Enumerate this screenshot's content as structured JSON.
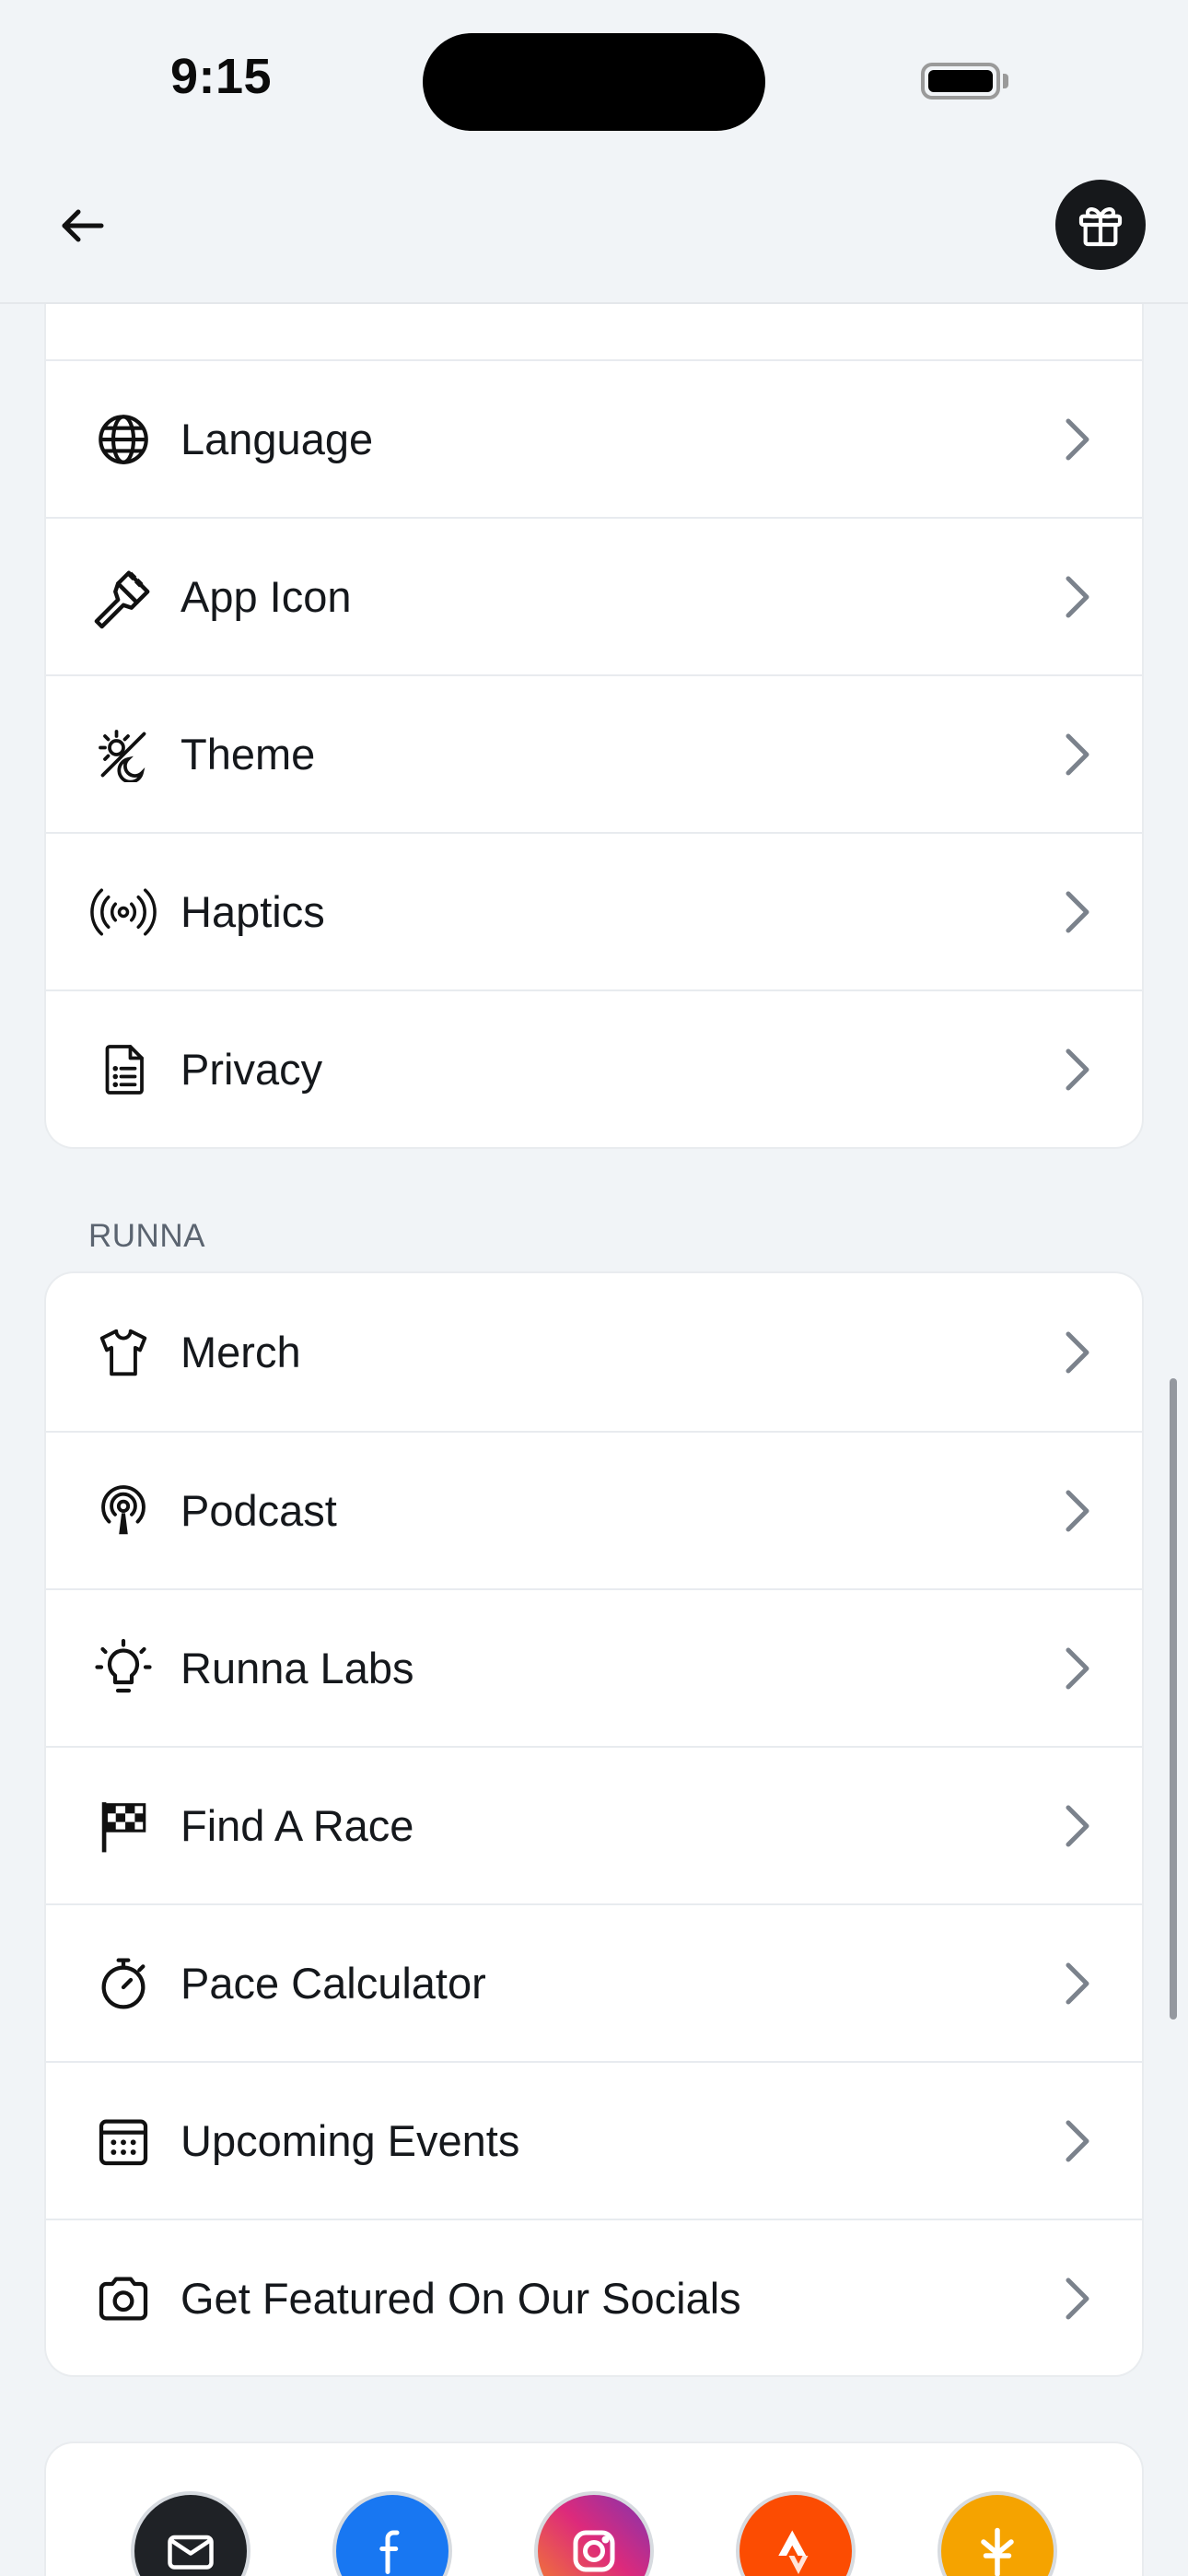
{
  "status": {
    "time": "9:15"
  },
  "settings_rows": [
    {
      "label": "Language",
      "icon": "globe-icon"
    },
    {
      "label": "App Icon",
      "icon": "paintbrush-icon"
    },
    {
      "label": "Theme",
      "icon": "theme-icon"
    },
    {
      "label": "Haptics",
      "icon": "haptics-icon"
    },
    {
      "label": "Privacy",
      "icon": "document-list-icon"
    }
  ],
  "runna_section": {
    "header": "RUNNA",
    "rows": [
      {
        "label": "Merch",
        "icon": "tshirt-icon"
      },
      {
        "label": "Podcast",
        "icon": "podcast-icon"
      },
      {
        "label": "Runna Labs",
        "icon": "lightbulb-icon"
      },
      {
        "label": "Find A Race",
        "icon": "checkered-flag-icon"
      },
      {
        "label": "Pace Calculator",
        "icon": "stopwatch-icon"
      },
      {
        "label": "Upcoming Events",
        "icon": "calendar-icon"
      },
      {
        "label": "Get Featured On Our Socials",
        "icon": "camera-icon"
      }
    ]
  },
  "socials": [
    {
      "name": "email",
      "icon": "mail-icon",
      "color": "#1f2226"
    },
    {
      "name": "facebook",
      "icon": "facebook-icon",
      "color": "#1877f2"
    },
    {
      "name": "instagram",
      "icon": "instagram-icon",
      "color": "#d6317a"
    },
    {
      "name": "strava",
      "icon": "strava-icon",
      "color": "#fc4c02"
    },
    {
      "name": "linktree",
      "icon": "linktree-icon",
      "color": "#f5a300"
    }
  ]
}
